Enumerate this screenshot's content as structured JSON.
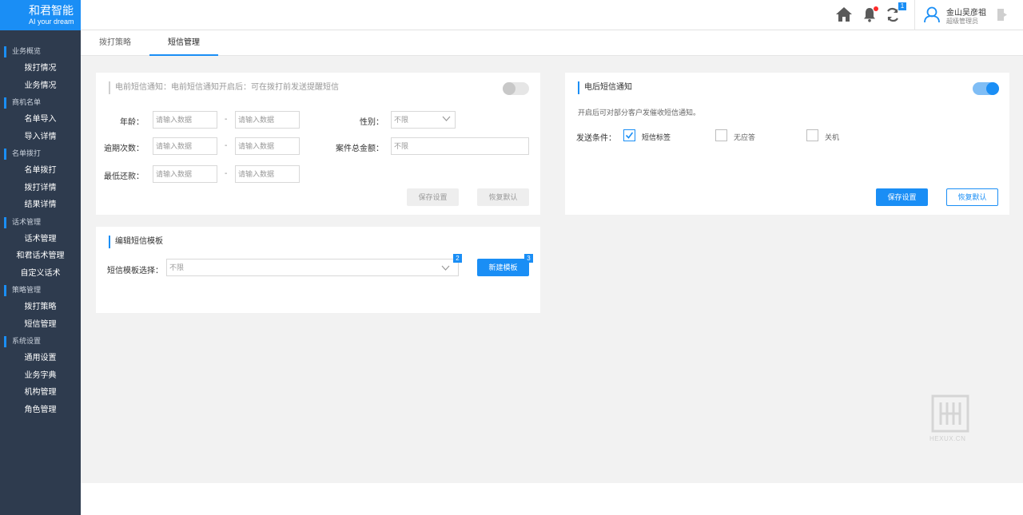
{
  "app": {
    "logo_title": "和君智能",
    "logo_subtitle": "AI  your dream"
  },
  "sidebar": {
    "groups": [
      {
        "label": "业务概览",
        "items": [
          "拨打情况",
          "业务情况"
        ]
      },
      {
        "label": "商机名单",
        "items": [
          "名单导入",
          "导入详情"
        ]
      },
      {
        "label": "名单拨打",
        "items": [
          "名单拨打",
          "拨打详情",
          "结果详情"
        ]
      },
      {
        "label": "话术管理",
        "items": [
          "话术管理",
          "和君话术管理",
          "自定义话术"
        ]
      },
      {
        "label": "策略管理",
        "items": [
          "拨打策略",
          "短信管理"
        ]
      },
      {
        "label": "系统设置",
        "items": [
          "通用设置",
          "业务字典",
          "机构管理",
          "角色管理"
        ]
      }
    ]
  },
  "header": {
    "icons": [
      "home-icon",
      "bell-icon",
      "refresh-icon",
      "user-icon",
      "logout-icon"
    ],
    "refresh_badge": "1",
    "user_name": "金山吴彦祖",
    "user_role": "超级管理员"
  },
  "tabs": [
    {
      "label": "拨打策略",
      "active": false
    },
    {
      "label": "短信管理",
      "active": true
    }
  ],
  "pre_call_panel": {
    "title": "电前短信通知：电前短信通知开启后：可在拨打前发送提醒短信",
    "enabled": false,
    "age_label": "年龄：",
    "overdue_label": "逾期次数：",
    "min_repay_label": "最低还款：",
    "gender_label": "性别：",
    "total_amount_label": "案件总金额：",
    "input_placeholder": "请输入数据",
    "range_separator": "-",
    "gender_value": "不限",
    "total_amount_value": "不限",
    "save_label": "保存设置",
    "reset_label": "恢复默认"
  },
  "post_call_panel": {
    "title": "电后短信通知",
    "enabled": true,
    "description": "开启后可对部分客户发催收短信通知。",
    "condition_label": "发送条件：",
    "options": [
      {
        "label": "短信标签",
        "checked": true
      },
      {
        "label": "无应答",
        "checked": false
      },
      {
        "label": "关机",
        "checked": false
      }
    ],
    "save_label": "保存设置",
    "reset_label": "恢复默认"
  },
  "template_panel": {
    "title": "编辑短信模板",
    "select_label": "短信模板选择：",
    "select_value": "不限",
    "select_badge": "2",
    "new_label": "新建模板",
    "new_badge": "3"
  },
  "watermark": "HEXUX.CN",
  "colors": {
    "accent": "#1a8ef5",
    "sidebar_bg": "#2e3b4e",
    "page_bg": "#f2f2f2"
  }
}
